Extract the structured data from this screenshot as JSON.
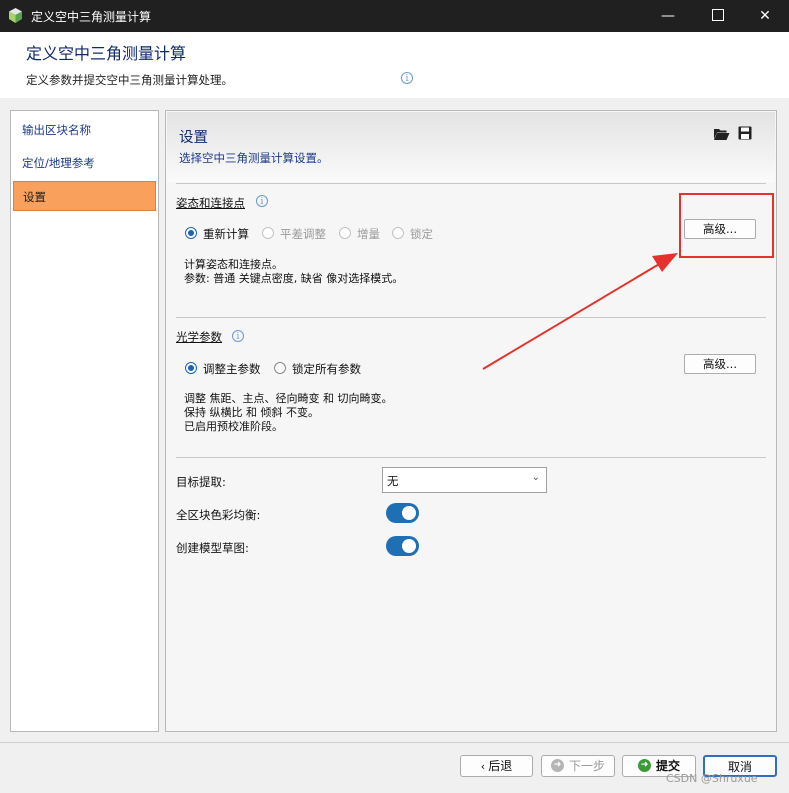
{
  "window": {
    "title": "定义空中三角测量计算",
    "min_glyph": "—",
    "close_glyph": "✕"
  },
  "header": {
    "title": "定义空中三角测量计算",
    "description": "定义参数并提交空中三角测量计算处理。"
  },
  "sidebar": {
    "items": [
      {
        "label": "输出区块名称"
      },
      {
        "label": "定位/地理参考"
      },
      {
        "label": "设置"
      }
    ]
  },
  "main": {
    "title": "设置",
    "subtitle": "选择空中三角测量计算设置。",
    "pose": {
      "label": "姿态和连接点",
      "options": [
        "重新计算",
        "平差调整",
        "增量",
        "锁定"
      ],
      "selected": "重新计算",
      "desc": [
        "计算姿态和连接点。",
        "参数: 普通 关键点密度, 缺省 像对选择模式。"
      ],
      "advanced_label": "高级..."
    },
    "optics": {
      "label": "光学参数",
      "options": [
        "调整主参数",
        "锁定所有参数"
      ],
      "selected": "调整主参数",
      "desc": [
        "调整 焦距、主点、径向畸变 和 切向畸变。",
        "保持 纵横比 和 倾斜 不变。",
        "已启用预校准阶段。"
      ],
      "advanced_label": "高级..."
    },
    "target_extraction": {
      "label": "目标提取:",
      "value": "无"
    },
    "color_balance": {
      "label": "全区块色彩均衡:",
      "enabled": true
    },
    "draft_model": {
      "label": "创建模型草图:",
      "enabled": true
    }
  },
  "footer": {
    "back": "后退",
    "next": "下一步",
    "submit": "提交",
    "cancel": "取消"
  },
  "watermark": "CSDN @Shruxue",
  "colors": {
    "accent": "#1f6fb5",
    "sidebar_active": "#f8a05c",
    "annotation": "#e5322d"
  }
}
